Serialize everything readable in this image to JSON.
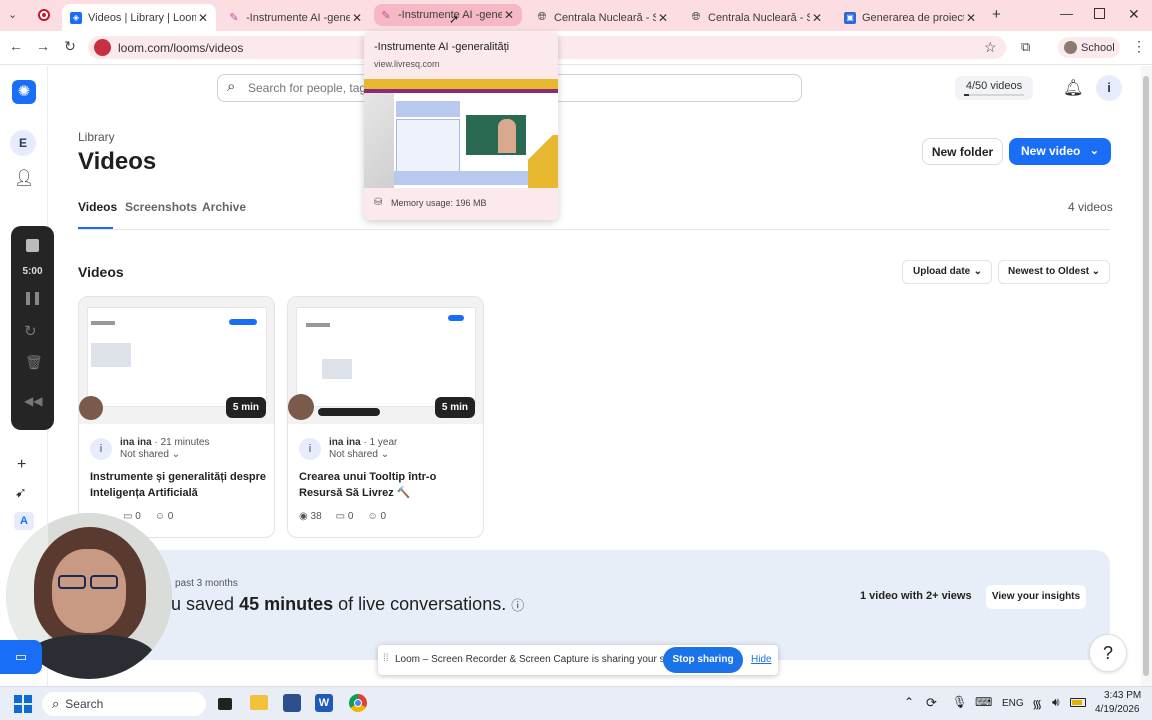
{
  "browser": {
    "tabs": [
      {
        "title": "Videos | Library | Loom",
        "active": true
      },
      {
        "title": "-Instrumente AI -generalități",
        "active": false
      },
      {
        "title": "-Instrumente AI -generalități",
        "active": false,
        "hovered": true
      },
      {
        "title": "Centrala Nucleară - Simulare",
        "active": false
      },
      {
        "title": "Centrala Nucleară - Simulare",
        "active": false
      },
      {
        "title": "Generarea de proiecte didactice",
        "active": false
      }
    ],
    "url": "loom.com/looms/videos",
    "profile_label": "School",
    "tooltip": {
      "title": "-Instrumente AI -generalități",
      "domain": "view.livresq.com",
      "memory": "Memory usage: 196 MB"
    }
  },
  "loom": {
    "search_placeholder": "Search for people, tags, folders, spaces, and Looms",
    "video_quota": "4/50 videos",
    "user_initial": "i",
    "workspace_initial": "E",
    "breadcrumb": "Library",
    "page_title": "Videos",
    "new_folder_label": "New folder",
    "new_video_label": "New video",
    "tabs": [
      "Videos",
      "Screenshots",
      "Archive"
    ],
    "video_count": "4 videos",
    "section_title": "Videos",
    "sort_upload": "Upload date",
    "sort_order": "Newest to Oldest",
    "recorder": {
      "timer": "5:00"
    },
    "cards": [
      {
        "author": "ina ina",
        "age": "21 minutes",
        "sharing": "Not shared",
        "title": "Instrumente și generalități despre Inteligența Artificială",
        "duration": "5 min",
        "views": "",
        "comments": "0",
        "reactions": "0"
      },
      {
        "author": "ina ina",
        "age": "1 year",
        "sharing": "Not shared",
        "title": "Crearea unui Tooltip într-o Resursă Să Livrez 🔨",
        "duration": "5 min",
        "views": "38",
        "comments": "0",
        "reactions": "0"
      }
    ],
    "insights": {
      "period": "past 3 months",
      "saved_prefix": "u saved",
      "saved_value": "45 minutes",
      "saved_suffix": "of live conversations.",
      "views_stat": "1 video with 2+ views",
      "cta": "View your insights"
    },
    "help_label": "?",
    "rail_letter": "A"
  },
  "share_bar": {
    "message": "Loom – Screen Recorder & Screen Capture is sharing your screen.",
    "stop_label": "Stop sharing",
    "hide_label": "Hide"
  },
  "taskbar": {
    "search_label": "Search",
    "language": "ENG",
    "time": "3:43 PM",
    "date": "4/19/2026"
  },
  "colors": {
    "accent": "#1a6ef5",
    "tabstrip": "#fbdde2",
    "insights_bg": "#e8eef8"
  }
}
